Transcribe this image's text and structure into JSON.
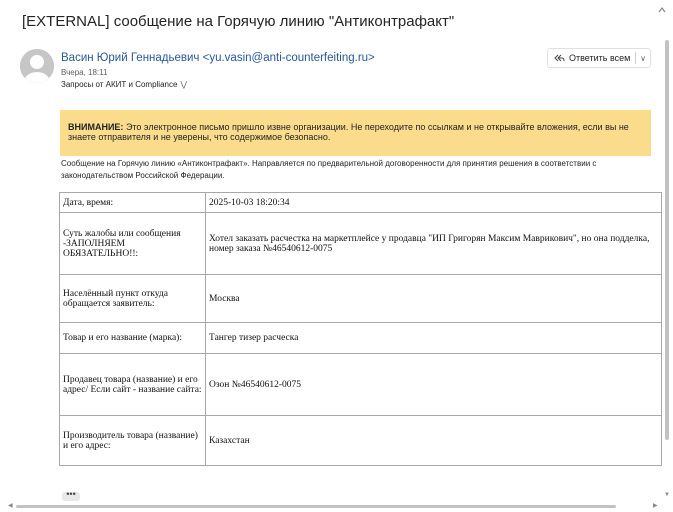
{
  "message": {
    "subject": "[EXTERNAL] сообщение на Горячую линию \"Антиконтрафакт\"",
    "sender_name": "Васин Юрий Геннадьевич",
    "sender_email": "<yu.vasin@anti-counterfeiting.ru>",
    "date": "Вчера, 18:11",
    "recipients": "Запросы от АКИТ и Compliance",
    "reply_all_label": "Ответить всем"
  },
  "warning": {
    "label": "ВНИМАНИЕ:",
    "text": " Это электронное письмо пришло извне организации. Не переходите по ссылкам и не открывайте вложения, если вы не знаете отправителя и не уверены, что содержимое безопасно."
  },
  "intro": "Сообщение на Горячую линию «Антиконтрафакт». Направляется по предварительной договоренности для принятия решения в соответствии с законодательством Российской Федерации.",
  "form": {
    "rows": [
      {
        "key": "Дата, время:",
        "value": "2025-10-03 18:20:34"
      },
      {
        "key": "Суть жалобы или сообщения -ЗАПОЛНЯЕМ ОБЯЗАТЕЛЬНО!!:",
        "value": "Хотел заказать расчестка на маркетплейсе у продавца \"ИП Григорян Максим Маврикович\", но она подделка, номер заказа №46540612-0075"
      },
      {
        "key": "Населённый пункт откуда обращается заявитель:",
        "value": "Москва"
      },
      {
        "key": "Товар и его название (марка):",
        "value": "Тангер тизер расческа"
      },
      {
        "key": "Продавец товара (название) и его адрес/ Если сайт - название сайта:",
        "value": "Озон №46540612-0075"
      },
      {
        "key": "Производитель товара (название) и его адрес:",
        "value": "Казахстан"
      }
    ]
  },
  "more_label": "•••"
}
